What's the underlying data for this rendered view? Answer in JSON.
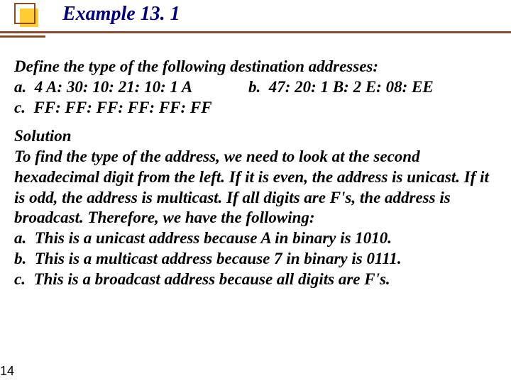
{
  "header": {
    "title": "Example 13. 1"
  },
  "question": {
    "prompt": "Define the type of the following destination addresses:",
    "a_label": "a.",
    "a_value": "4 A: 30: 10: 21: 10: 1 A",
    "b_label": "b.",
    "b_value": "47: 20: 1 B: 2 E: 08: EE",
    "c_label": "c.",
    "c_value": "FF: FF: FF: FF: FF: FF"
  },
  "solution": {
    "heading": "Solution",
    "body": "To find the type of the address, we need to look at the second hexadecimal digit from the left. If it is even, the address is unicast. If it is odd, the address is multicast. If all digits are F's, the address is broadcast. Therefore, we have the following:",
    "a_label": "a.",
    "a_text": "This is a unicast address because A in binary is 1010.",
    "b_label": "b.",
    "b_text": "This is a multicast address because 7 in binary is 0111.",
    "c_label": "c.",
    "c_text": "This is a broadcast address because all digits are F's."
  },
  "footer": {
    "page_number": "14"
  }
}
